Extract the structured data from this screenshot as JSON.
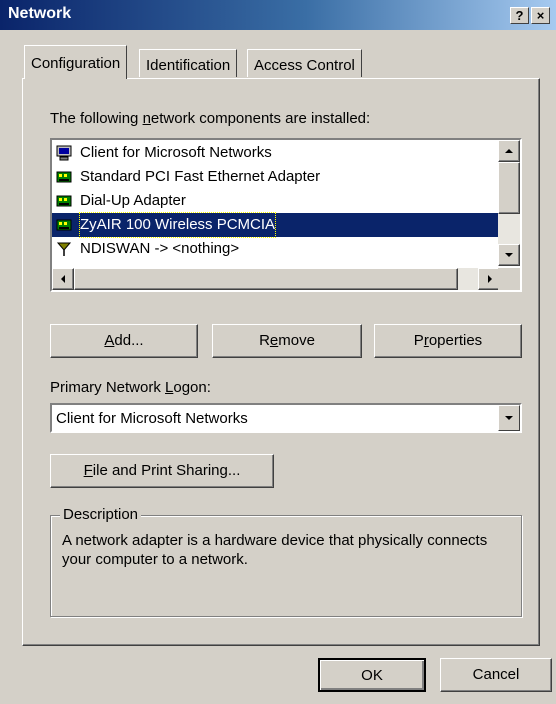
{
  "window": {
    "title": "Network",
    "help_glyph": "?",
    "close_glyph": "×"
  },
  "tabs": [
    {
      "label": "Configuration",
      "active": true
    },
    {
      "label": "Identification",
      "active": false
    },
    {
      "label": "Access Control",
      "active": false
    }
  ],
  "components": {
    "label_pre": "The following ",
    "label_u": "n",
    "label_post": "etwork components are installed:",
    "items": [
      {
        "label": "Client for Microsoft Networks",
        "icon": "client-icon",
        "selected": false
      },
      {
        "label": "Standard PCI Fast Ethernet Adapter",
        "icon": "network-adapter-icon",
        "selected": false
      },
      {
        "label": "Dial-Up Adapter",
        "icon": "network-adapter-icon",
        "selected": false
      },
      {
        "label": "ZyAIR 100 Wireless PCMCIA",
        "icon": "network-adapter-icon",
        "selected": true
      },
      {
        "label": "NDISWAN -> <nothing>",
        "icon": "protocol-icon",
        "selected": false
      }
    ]
  },
  "buttons": {
    "add_u": "A",
    "add_rest": "dd...",
    "remove_pre": "R",
    "remove_u": "e",
    "remove_post": "move",
    "properties_pre": "P",
    "properties_u": "r",
    "properties_post": "operties"
  },
  "logon": {
    "label_pre": "Primary Network ",
    "label_u": "L",
    "label_post": "ogon:",
    "value": "Client for Microsoft Networks"
  },
  "sharing": {
    "u": "F",
    "rest": "ile and Print Sharing..."
  },
  "description": {
    "title": "Description",
    "text": "A network adapter is a hardware device that physically connects your computer to a network."
  },
  "footer": {
    "ok": "OK",
    "cancel": "Cancel"
  },
  "colors": {
    "selection": "#0a246a",
    "face": "#d4d0c8",
    "title_gradient_start": "#0a246a"
  }
}
